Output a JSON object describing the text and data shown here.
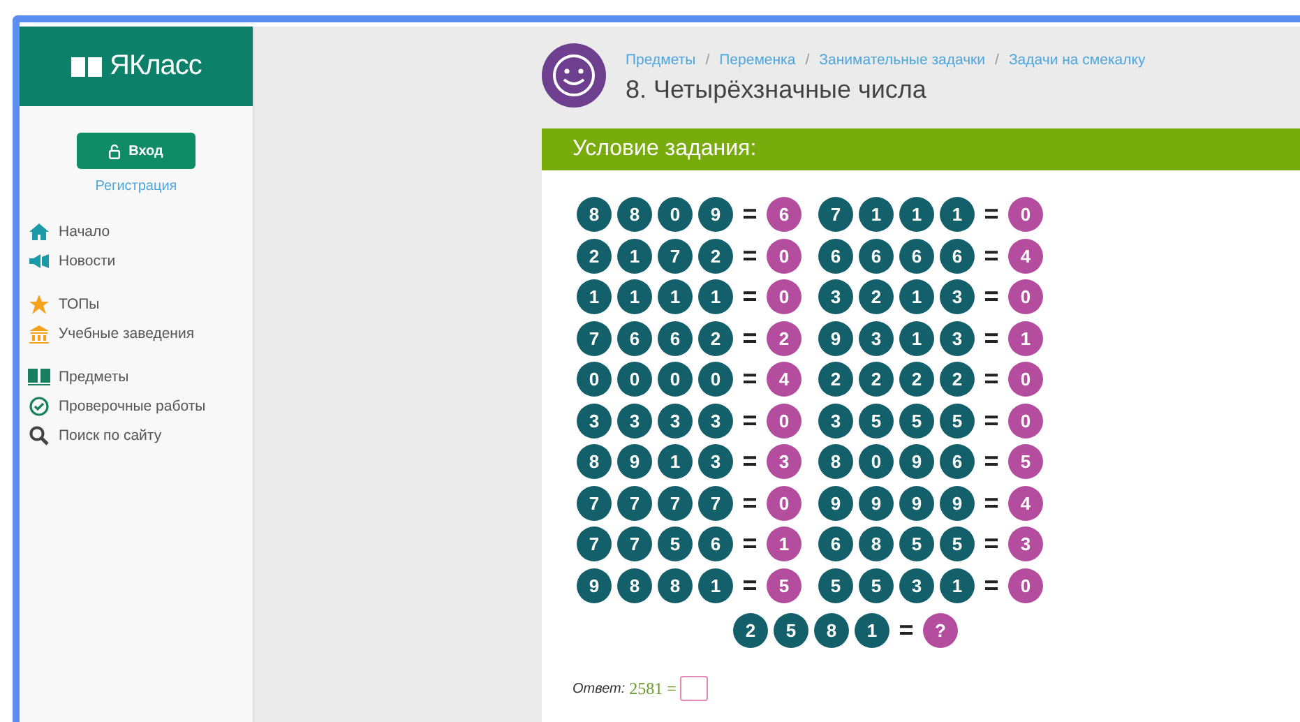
{
  "sidebar": {
    "logo": "ЯКласс",
    "login_button": "Вход",
    "register_link": "Регистрация",
    "nav_groups": [
      [
        {
          "label": "Начало"
        },
        {
          "label": "Новости"
        }
      ],
      [
        {
          "label": "ТОПы"
        },
        {
          "label": "Учебные заведения"
        }
      ],
      [
        {
          "label": "Предметы"
        },
        {
          "label": "Проверочные работы"
        },
        {
          "label": "Поиск по сайту"
        }
      ]
    ]
  },
  "breadcrumbs": [
    "Предметы",
    "Переменка",
    "Занимательные задачки",
    "Задачи на смекалку"
  ],
  "breadcrumb_separator": "/",
  "title": "8. Четырёхзначные числа",
  "task": {
    "heading": "Условие задания:",
    "equations": [
      [
        {
          "digits": [
            "8",
            "8",
            "0",
            "9"
          ],
          "result": "6"
        },
        {
          "digits": [
            "7",
            "1",
            "1",
            "1"
          ],
          "result": "0"
        }
      ],
      [
        {
          "digits": [
            "2",
            "1",
            "7",
            "2"
          ],
          "result": "0"
        },
        {
          "digits": [
            "6",
            "6",
            "6",
            "6"
          ],
          "result": "4"
        }
      ],
      [
        {
          "digits": [
            "1",
            "1",
            "1",
            "1"
          ],
          "result": "0"
        },
        {
          "digits": [
            "3",
            "2",
            "1",
            "3"
          ],
          "result": "0"
        }
      ],
      [
        {
          "digits": [
            "7",
            "6",
            "6",
            "2"
          ],
          "result": "2"
        },
        {
          "digits": [
            "9",
            "3",
            "1",
            "3"
          ],
          "result": "1"
        }
      ],
      [
        {
          "digits": [
            "0",
            "0",
            "0",
            "0"
          ],
          "result": "4"
        },
        {
          "digits": [
            "2",
            "2",
            "2",
            "2"
          ],
          "result": "0"
        }
      ],
      [
        {
          "digits": [
            "3",
            "3",
            "3",
            "3"
          ],
          "result": "0"
        },
        {
          "digits": [
            "3",
            "5",
            "5",
            "5"
          ],
          "result": "0"
        }
      ],
      [
        {
          "digits": [
            "8",
            "9",
            "1",
            "3"
          ],
          "result": "3"
        },
        {
          "digits": [
            "8",
            "0",
            "9",
            "6"
          ],
          "result": "5"
        }
      ],
      [
        {
          "digits": [
            "7",
            "7",
            "7",
            "7"
          ],
          "result": "0"
        },
        {
          "digits": [
            "9",
            "9",
            "9",
            "9"
          ],
          "result": "4"
        }
      ],
      [
        {
          "digits": [
            "7",
            "7",
            "5",
            "6"
          ],
          "result": "1"
        },
        {
          "digits": [
            "6",
            "8",
            "5",
            "5"
          ],
          "result": "3"
        }
      ],
      [
        {
          "digits": [
            "9",
            "8",
            "8",
            "1"
          ],
          "result": "5"
        },
        {
          "digits": [
            "5",
            "5",
            "3",
            "1"
          ],
          "result": "0"
        }
      ]
    ],
    "question": {
      "digits": [
        "2",
        "5",
        "8",
        "1"
      ],
      "result": "?"
    },
    "equals": "=",
    "answer": {
      "label": "Ответ:",
      "expression": "2581 ="
    }
  }
}
